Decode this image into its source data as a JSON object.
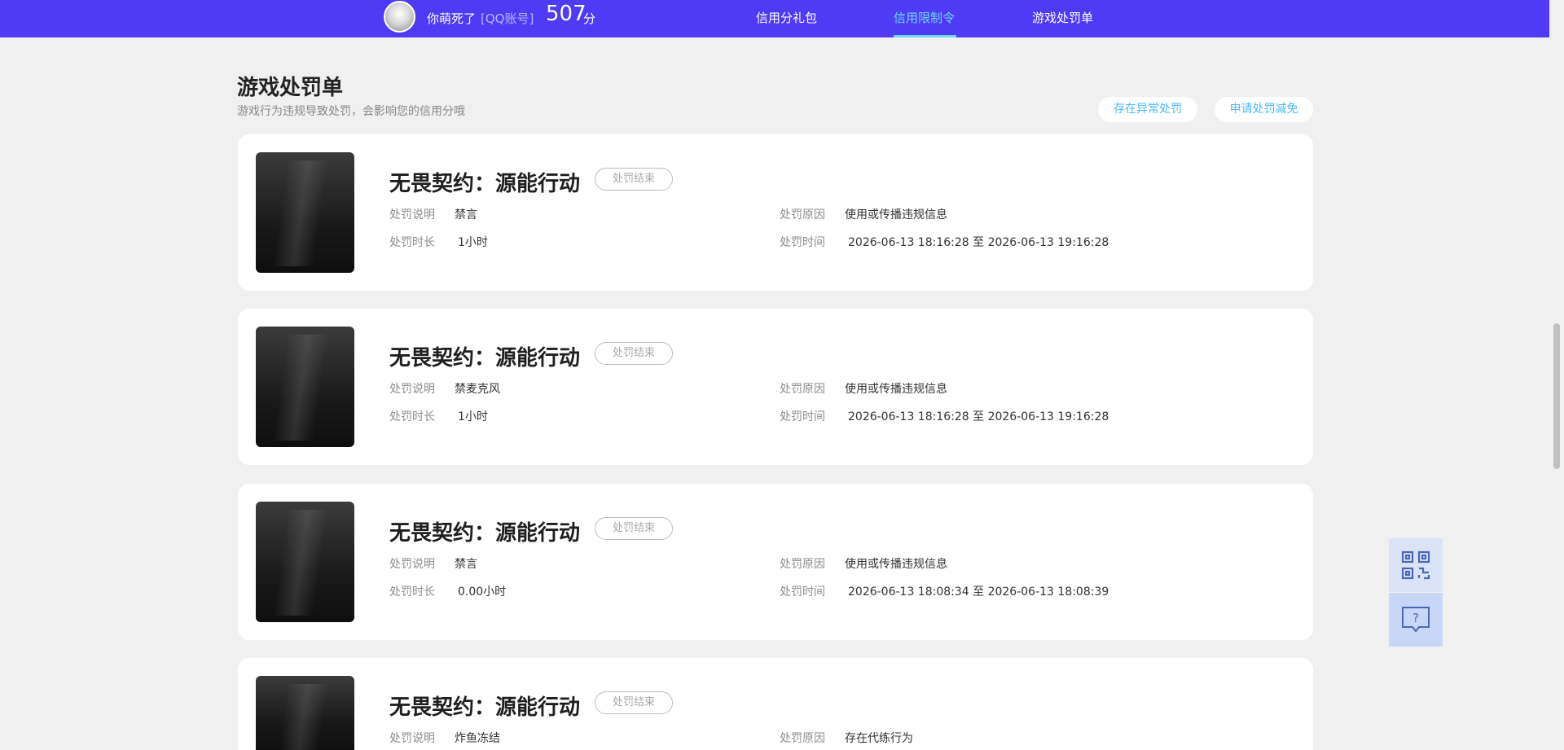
{
  "header": {
    "nickname": "你萌死了",
    "account": "[QQ账号]",
    "score": "507",
    "score_unit": "分",
    "nav": [
      {
        "label": "信用分礼包",
        "active": false
      },
      {
        "label": "信用限制令",
        "active": true
      },
      {
        "label": "游戏处罚单",
        "active": false
      }
    ]
  },
  "page": {
    "title": "游戏处罚单",
    "subtitle": "游戏行为违规导致处罚，会影响您的信用分哦",
    "btn_abnormal": "存在异常处罚",
    "btn_reduce": "申请处罚减免"
  },
  "labels": {
    "desc": "处罚说明",
    "duration": "处罚时长",
    "reason": "处罚原因",
    "time": "处罚时间"
  },
  "records": [
    {
      "game": "无畏契约：源能行动",
      "status": "处罚结束",
      "desc": "禁言",
      "duration": "1小时",
      "reason": "使用或传播违规信息",
      "time": "2026-06-13 18:16:28 至 2026-06-13 19:16:28"
    },
    {
      "game": "无畏契约：源能行动",
      "status": "处罚结束",
      "desc": "禁麦克风",
      "duration": "1小时",
      "reason": "使用或传播违规信息",
      "time": "2026-06-13 18:16:28 至 2026-06-13 19:16:28"
    },
    {
      "game": "无畏契约：源能行动",
      "status": "处罚结束",
      "desc": "禁言",
      "duration": "0.00小时",
      "reason": "使用或传播违规信息",
      "time": "2026-06-13 18:08:34 至 2026-06-13 18:08:39"
    },
    {
      "game": "无畏契约：源能行动",
      "status": "处罚结束",
      "desc": "炸鱼冻结",
      "reason": "存在代练行为"
    }
  ],
  "colors": {
    "header_bg": "#4f3bf6",
    "active_nav": "#6fd6ff",
    "pill_text": "#4ab9ff"
  },
  "side_tools": [
    {
      "icon": "qrcode-icon"
    },
    {
      "icon": "help-chat-icon"
    }
  ]
}
